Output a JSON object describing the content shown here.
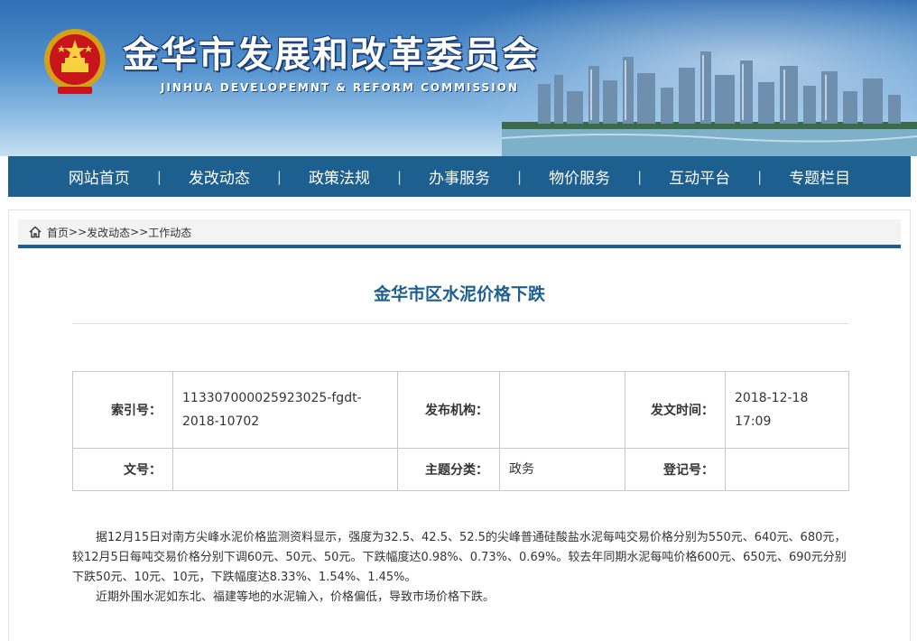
{
  "header": {
    "site_title": "金华市发展和改革委员会",
    "site_subtitle": "JINHUA DEVELOPEMNT & REFORM COMMISSION",
    "emblem_icon": "national-emblem-icon"
  },
  "nav": {
    "items": [
      "网站首页",
      "发改动态",
      "政策法规",
      "办事服务",
      "物价服务",
      "互动平台",
      "专题栏目"
    ],
    "separator": "|"
  },
  "breadcrumb": {
    "icon": "home-icon",
    "home": "首页",
    "sep": ">>",
    "level1": "发改动态",
    "level2": "工作动态"
  },
  "article": {
    "title": "金华市区水泥价格下跌",
    "meta": {
      "index_label": "索引号：",
      "index_value_line1": "113307000025923025-fgdt-",
      "index_value_line2": "2018-10702",
      "publisher_label": "发布机构：",
      "publisher_value": "",
      "date_label": "发文时间：",
      "date_value_line1": "2018-12-18",
      "date_value_line2": "17:09",
      "doc_no_label": "文号：",
      "doc_no_value": "",
      "topic_label": "主题分类：",
      "topic_value": "政务",
      "reg_label": "登记号：",
      "reg_value": ""
    },
    "paragraphs": [
      "据12月15日对南方尖峰水泥价格监测资料显示，强度为32.5、42.5、52.5的尖峰普通硅酸盐水泥每吨交易价格分别为550元、640元、680元，较12月5日每吨交易价格分别下调60元、50元、50元。下跌幅度达0.98%、0.73%、0.69%。较去年同期水泥每吨价格600元、650元、690元分别下跌50元、10元、10元，下跌幅度达8.33%、1.54%、1.45%。",
      "近期外围水泥如东北、福建等地的水泥输入，价格偏低，导致市场价格下跌。"
    ]
  },
  "colors": {
    "nav_bg": "#1d5f8f",
    "title_color": "#1d5f8f",
    "banner_top": "#2f6fb4"
  }
}
